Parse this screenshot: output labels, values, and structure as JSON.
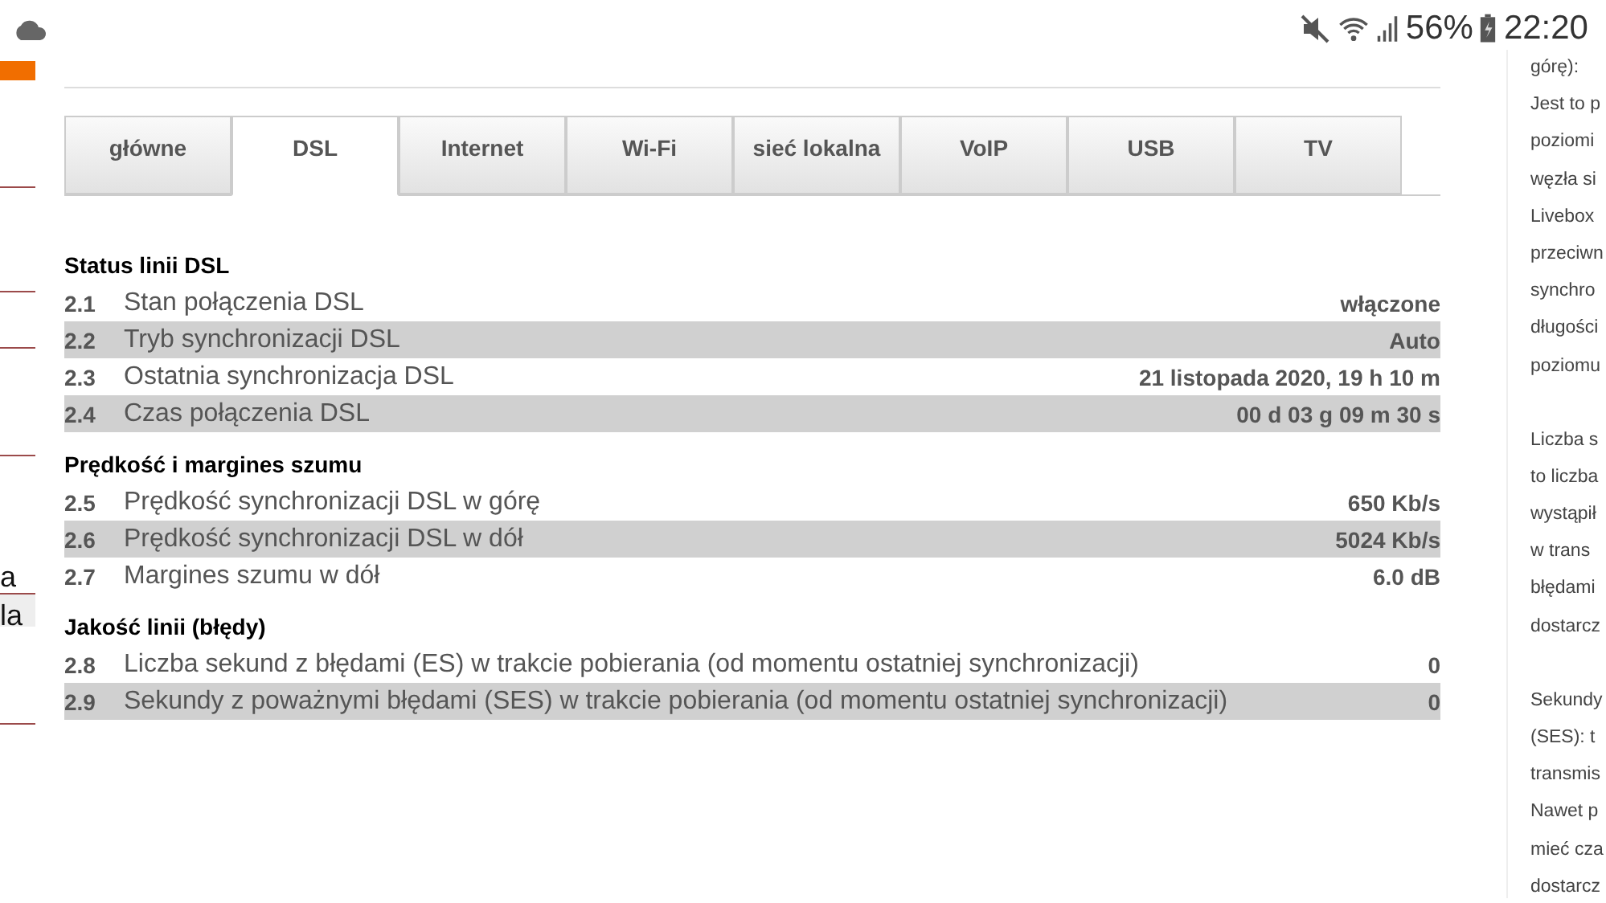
{
  "status_bar": {
    "battery": "56%",
    "time": "22:20"
  },
  "left_strip": {
    "texts": [
      "a",
      "la"
    ]
  },
  "tabs": [
    {
      "label": "główne",
      "selected": false
    },
    {
      "label": "DSL",
      "selected": true
    },
    {
      "label": "Internet",
      "selected": false
    },
    {
      "label": "Wi-Fi",
      "selected": false
    },
    {
      "label": "sieć lokalna",
      "selected": false
    },
    {
      "label": "VoIP",
      "selected": false
    },
    {
      "label": "USB",
      "selected": false
    },
    {
      "label": "TV",
      "selected": false
    }
  ],
  "sections": [
    {
      "title": "Status linii DSL",
      "rows": [
        {
          "number": "2.1",
          "label": "Stan połączenia DSL",
          "value": "włączone"
        },
        {
          "number": "2.2",
          "label": "Tryb synchronizacji DSL",
          "value": "Auto"
        },
        {
          "number": "2.3",
          "label": "Ostatnia synchronizacja DSL",
          "value": "21 listopada 2020, 19 h 10 m"
        },
        {
          "number": "2.4",
          "label": "Czas połączenia DSL",
          "value": "00 d 03 g 09 m 30 s"
        }
      ]
    },
    {
      "title": "Prędkość i margines szumu",
      "rows": [
        {
          "number": "2.5",
          "label": "Prędkość synchronizacji DSL w górę",
          "value": "650 Kb/s"
        },
        {
          "number": "2.6",
          "label": "Prędkość synchronizacji DSL w dół",
          "value": "5024 Kb/s"
        },
        {
          "number": "2.7",
          "label": "Margines szumu w dół",
          "value": "6.0 dB"
        }
      ]
    },
    {
      "title": "Jakość linii (błędy)",
      "rows": [
        {
          "number": "2.8",
          "label": "Liczba sekund z błędami (ES) w trakcie pobierania (od momentu ostatniej synchronizacji)",
          "value": "0"
        },
        {
          "number": "2.9",
          "label": "Sekundy z poważnymi błędami (SES) w trakcie pobierania (od momentu ostatniej synchronizacji)",
          "value": "0"
        }
      ]
    }
  ],
  "help_panel": {
    "paragraphs": [
      [
        "górę):",
        "Jest to p",
        "poziomi",
        "węzła si",
        "Livebox",
        "przeciwn",
        "synchro",
        "długości",
        "poziomu"
      ],
      [
        "Liczba s",
        "to liczba",
        "wystąpił",
        "w trans",
        "błędami",
        "dostarcz"
      ],
      [
        "Sekundy",
        "(SES): t",
        "transmis",
        "Nawet p",
        "mieć cza",
        "dostarcz"
      ]
    ]
  }
}
